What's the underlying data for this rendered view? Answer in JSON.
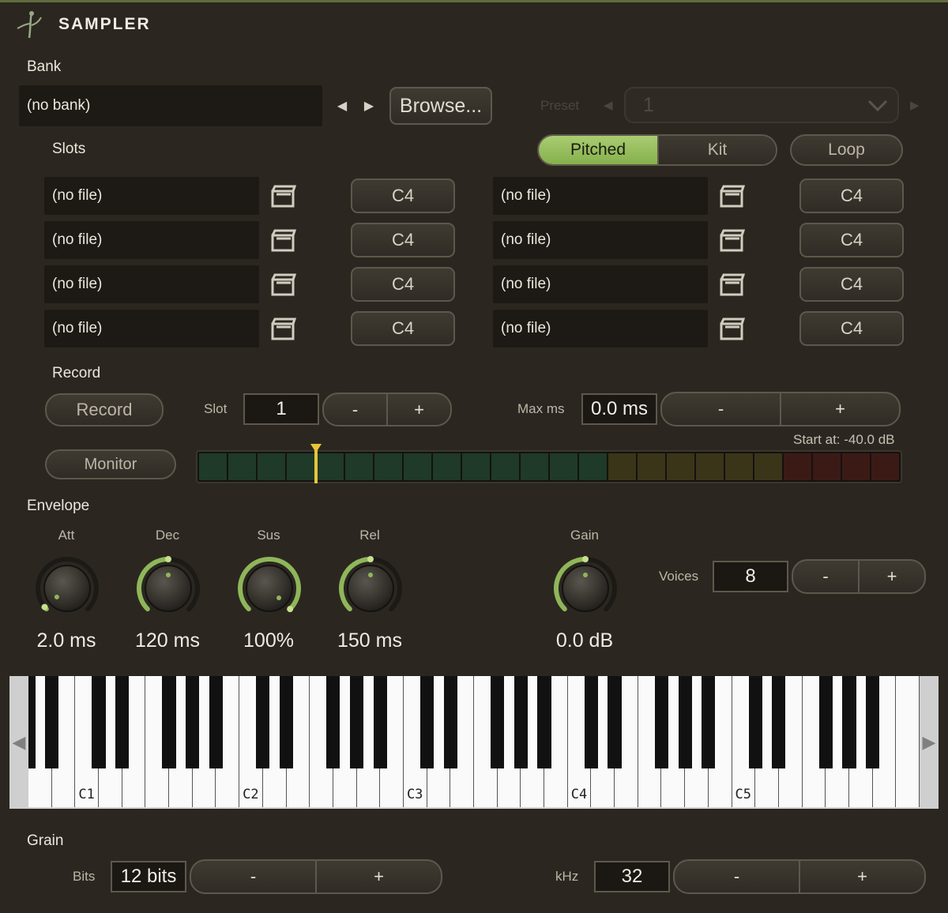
{
  "header": {
    "title": "SAMPLER",
    "logo_icon": "tuning-fork-leaf-icon"
  },
  "bank": {
    "section_label": "Bank",
    "value": "(no bank)",
    "browse_label": "Browse...",
    "preset_label": "Preset",
    "preset_value": "1"
  },
  "slots": {
    "section_label": "Slots",
    "mode_tabs": [
      "Pitched",
      "Kit"
    ],
    "active_mode": "Pitched",
    "loop_label": "Loop",
    "left": [
      {
        "file": "(no file)",
        "note": "C4"
      },
      {
        "file": "(no file)",
        "note": "C4"
      },
      {
        "file": "(no file)",
        "note": "C4"
      },
      {
        "file": "(no file)",
        "note": "C4"
      }
    ],
    "right": [
      {
        "file": "(no file)",
        "note": "C4"
      },
      {
        "file": "(no file)",
        "note": "C4"
      },
      {
        "file": "(no file)",
        "note": "C4"
      },
      {
        "file": "(no file)",
        "note": "C4"
      }
    ]
  },
  "record": {
    "section_label": "Record",
    "record_label": "Record",
    "slot_label": "Slot",
    "slot_value": "1",
    "minus": "-",
    "plus": "+",
    "maxms_label": "Max ms",
    "maxms_value": "0.0 ms",
    "start_at": "Start at: -40.0 dB",
    "monitor_label": "Monitor",
    "threshold_fraction": 0.17
  },
  "envelope": {
    "section_label": "Envelope",
    "knobs": [
      {
        "label": "Att",
        "value": "2.0 ms",
        "level": 0.02
      },
      {
        "label": "Dec",
        "value": "120 ms",
        "level": 0.5
      },
      {
        "label": "Sus",
        "value": "100%",
        "level": 1.0
      },
      {
        "label": "Rel",
        "value": "150 ms",
        "level": 0.5
      }
    ],
    "gain": {
      "label": "Gain",
      "value": "0.0 dB",
      "level": 0.5
    },
    "voices_label": "Voices",
    "voices_value": "8"
  },
  "keyboard": {
    "octave_labels": [
      "C1",
      "C2",
      "C3",
      "C4",
      "C5"
    ],
    "left_arrow": "◀",
    "right_arrow": "▶"
  },
  "grain": {
    "section_label": "Grain",
    "bits_label": "Bits",
    "bits_value": "12 bits",
    "khz_label": "kHz",
    "khz_value": "32"
  },
  "colors": {
    "accent": "#8fb65a",
    "background": "#2b2720",
    "threshold": "#e8c53a"
  }
}
